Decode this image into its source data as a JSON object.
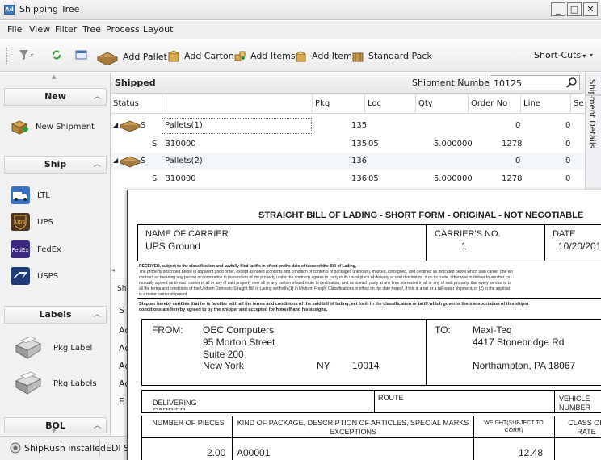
{
  "window": {
    "title": "Shipping Tree",
    "app_icon_text": "Ad",
    "minimize": "_",
    "maximize": "□",
    "close": "✕"
  },
  "menu": [
    "File",
    "View",
    "Filter",
    "Tree",
    "Process",
    "Layout"
  ],
  "toolbar": {
    "add_pallet": "Add Pallet",
    "add_carton": "Add Carton",
    "add_items": "Add Items",
    "add_item": "Add Item",
    "standard_pack": "Standard Pack",
    "shortcuts": "Short-Cuts"
  },
  "left": {
    "new": {
      "title": "New",
      "items": [
        {
          "label": "New Shipment",
          "icon": "new-shipment-icon"
        }
      ]
    },
    "ship": {
      "title": "Ship",
      "items": [
        {
          "label": "LTL",
          "icon": "truck-icon"
        },
        {
          "label": "UPS",
          "icon": "ups-icon"
        },
        {
          "label": "FedEx",
          "icon": "fedex-icon"
        },
        {
          "label": "USPS",
          "icon": "usps-icon"
        }
      ]
    },
    "labels": {
      "title": "Labels",
      "items": [
        {
          "label": "Pkg Label",
          "icon": "printer-icon"
        },
        {
          "label": "Pkg Labels",
          "icon": "printer-icon"
        }
      ]
    },
    "bol": {
      "title": "BOL"
    }
  },
  "grid": {
    "title": "Shipped",
    "shipment_number_label": "Shipment Number:",
    "shipment_number": "10125",
    "columns": [
      "Status",
      "Pkg",
      "Loc",
      "Qty",
      "Order No",
      "Line",
      "Se"
    ],
    "rows": [
      {
        "status": "S",
        "desc": "Pallets(1)",
        "pkg": "135",
        "loc": "",
        "qty": "",
        "order": "0",
        "line": "0"
      },
      {
        "status": "S",
        "desc": "B10000",
        "pkg": "135",
        "loc": "05",
        "qty": "5.000000",
        "order": "1278",
        "line": "0"
      },
      {
        "status": "S",
        "desc": "Pallets(2)",
        "pkg": "136",
        "loc": "",
        "qty": "",
        "order": "0",
        "line": "0"
      },
      {
        "status": "S",
        "desc": "B10000",
        "pkg": "136",
        "loc": "05",
        "qty": "5.000000",
        "order": "1278",
        "line": "0"
      }
    ]
  },
  "side_tab": "Shipment Details",
  "lower_panel": {
    "tab": "Sh",
    "list_header": "S",
    "items": [
      "Ac",
      "Ac",
      "Ac",
      "Ac",
      "E"
    ]
  },
  "statusbar": {
    "shiprush": "ShipRush installed",
    "edi": "EDI S"
  },
  "bol": {
    "title": "STRAIGHT BILL OF LADING - SHORT FORM - ORIGINAL - NOT NEGOTIABLE",
    "carrier_label": "NAME OF CARRIER",
    "carrier": "UPS Ground",
    "carrier_no_label": "CARRIER'S NO.",
    "carrier_no": "1",
    "date_label": "DATE",
    "date": "10/20/201",
    "received_line": "RECEIVED, subject to the classification and lawfully filed tariffs in effect on the date of issue of the Bill of Lading,",
    "fine_1": "The property described below in apparent good order, except as noted (contents and condition of contents of packages unknown), marked, consigned, and destined as indicated below which said carrier (the wo",
    "fine_2": "contract as meaning any person or corporation in possession of the property under the contract) agrees to carry to its usual place of delivery at said destination, if on its route, otherwise to deliver to another ca",
    "fine_3": "mutually agreed as to each carrier of all or any of said property over all or any portion of said route to destination, and as to each party at any time interested in all or any of said property, that every service to b",
    "fine_4": "all the terms and conditions of the Uniform Domestic Straight Bill of Lading set forth (1) in Uniform Freight Classifications in effect on the date hereof, if this is a rail or a rail-water shipment, or (2) in the applicat",
    "fine_5": "is a motor carrier shipment.",
    "certify_1": "Shipper hereby certifies that he is familiar with all the terms and conditions of the said bill of lading, set forth in the classification or tariff which governs the transportation of this shipm",
    "certify_2": "conditions are hereby agreed to by the shipper and accepted for himself and his assigns.",
    "from_label": "FROM:",
    "from_name": "OEC Computers",
    "from_addr1": "95 Morton Street",
    "from_addr2": "Suite 200",
    "from_city": "New York",
    "from_state": "NY",
    "from_zip": "10014",
    "to_label": "TO:",
    "to_name": "Maxi-Teq",
    "to_addr": "4417 Stonebridge Rd",
    "to_city": "Northampton, PA 18067",
    "delivering_label": "DELIVERING CARRIER",
    "route_label": "ROUTE",
    "vehicle_label": "VEHICLE NUMBER",
    "pieces_label": "NUMBER OF PIECES",
    "kind_label": "KIND OF PACKAGE, DESCRIPTION OF ARTICLES, SPECIAL MARKS EXCEPTIONS",
    "weight_label": "WEIGHT(SUBJECT TO CORR)",
    "class_label": "CLASS OR RATE",
    "line_pieces": "2.00",
    "line_item": "A00001",
    "line_weight": "12.48"
  }
}
